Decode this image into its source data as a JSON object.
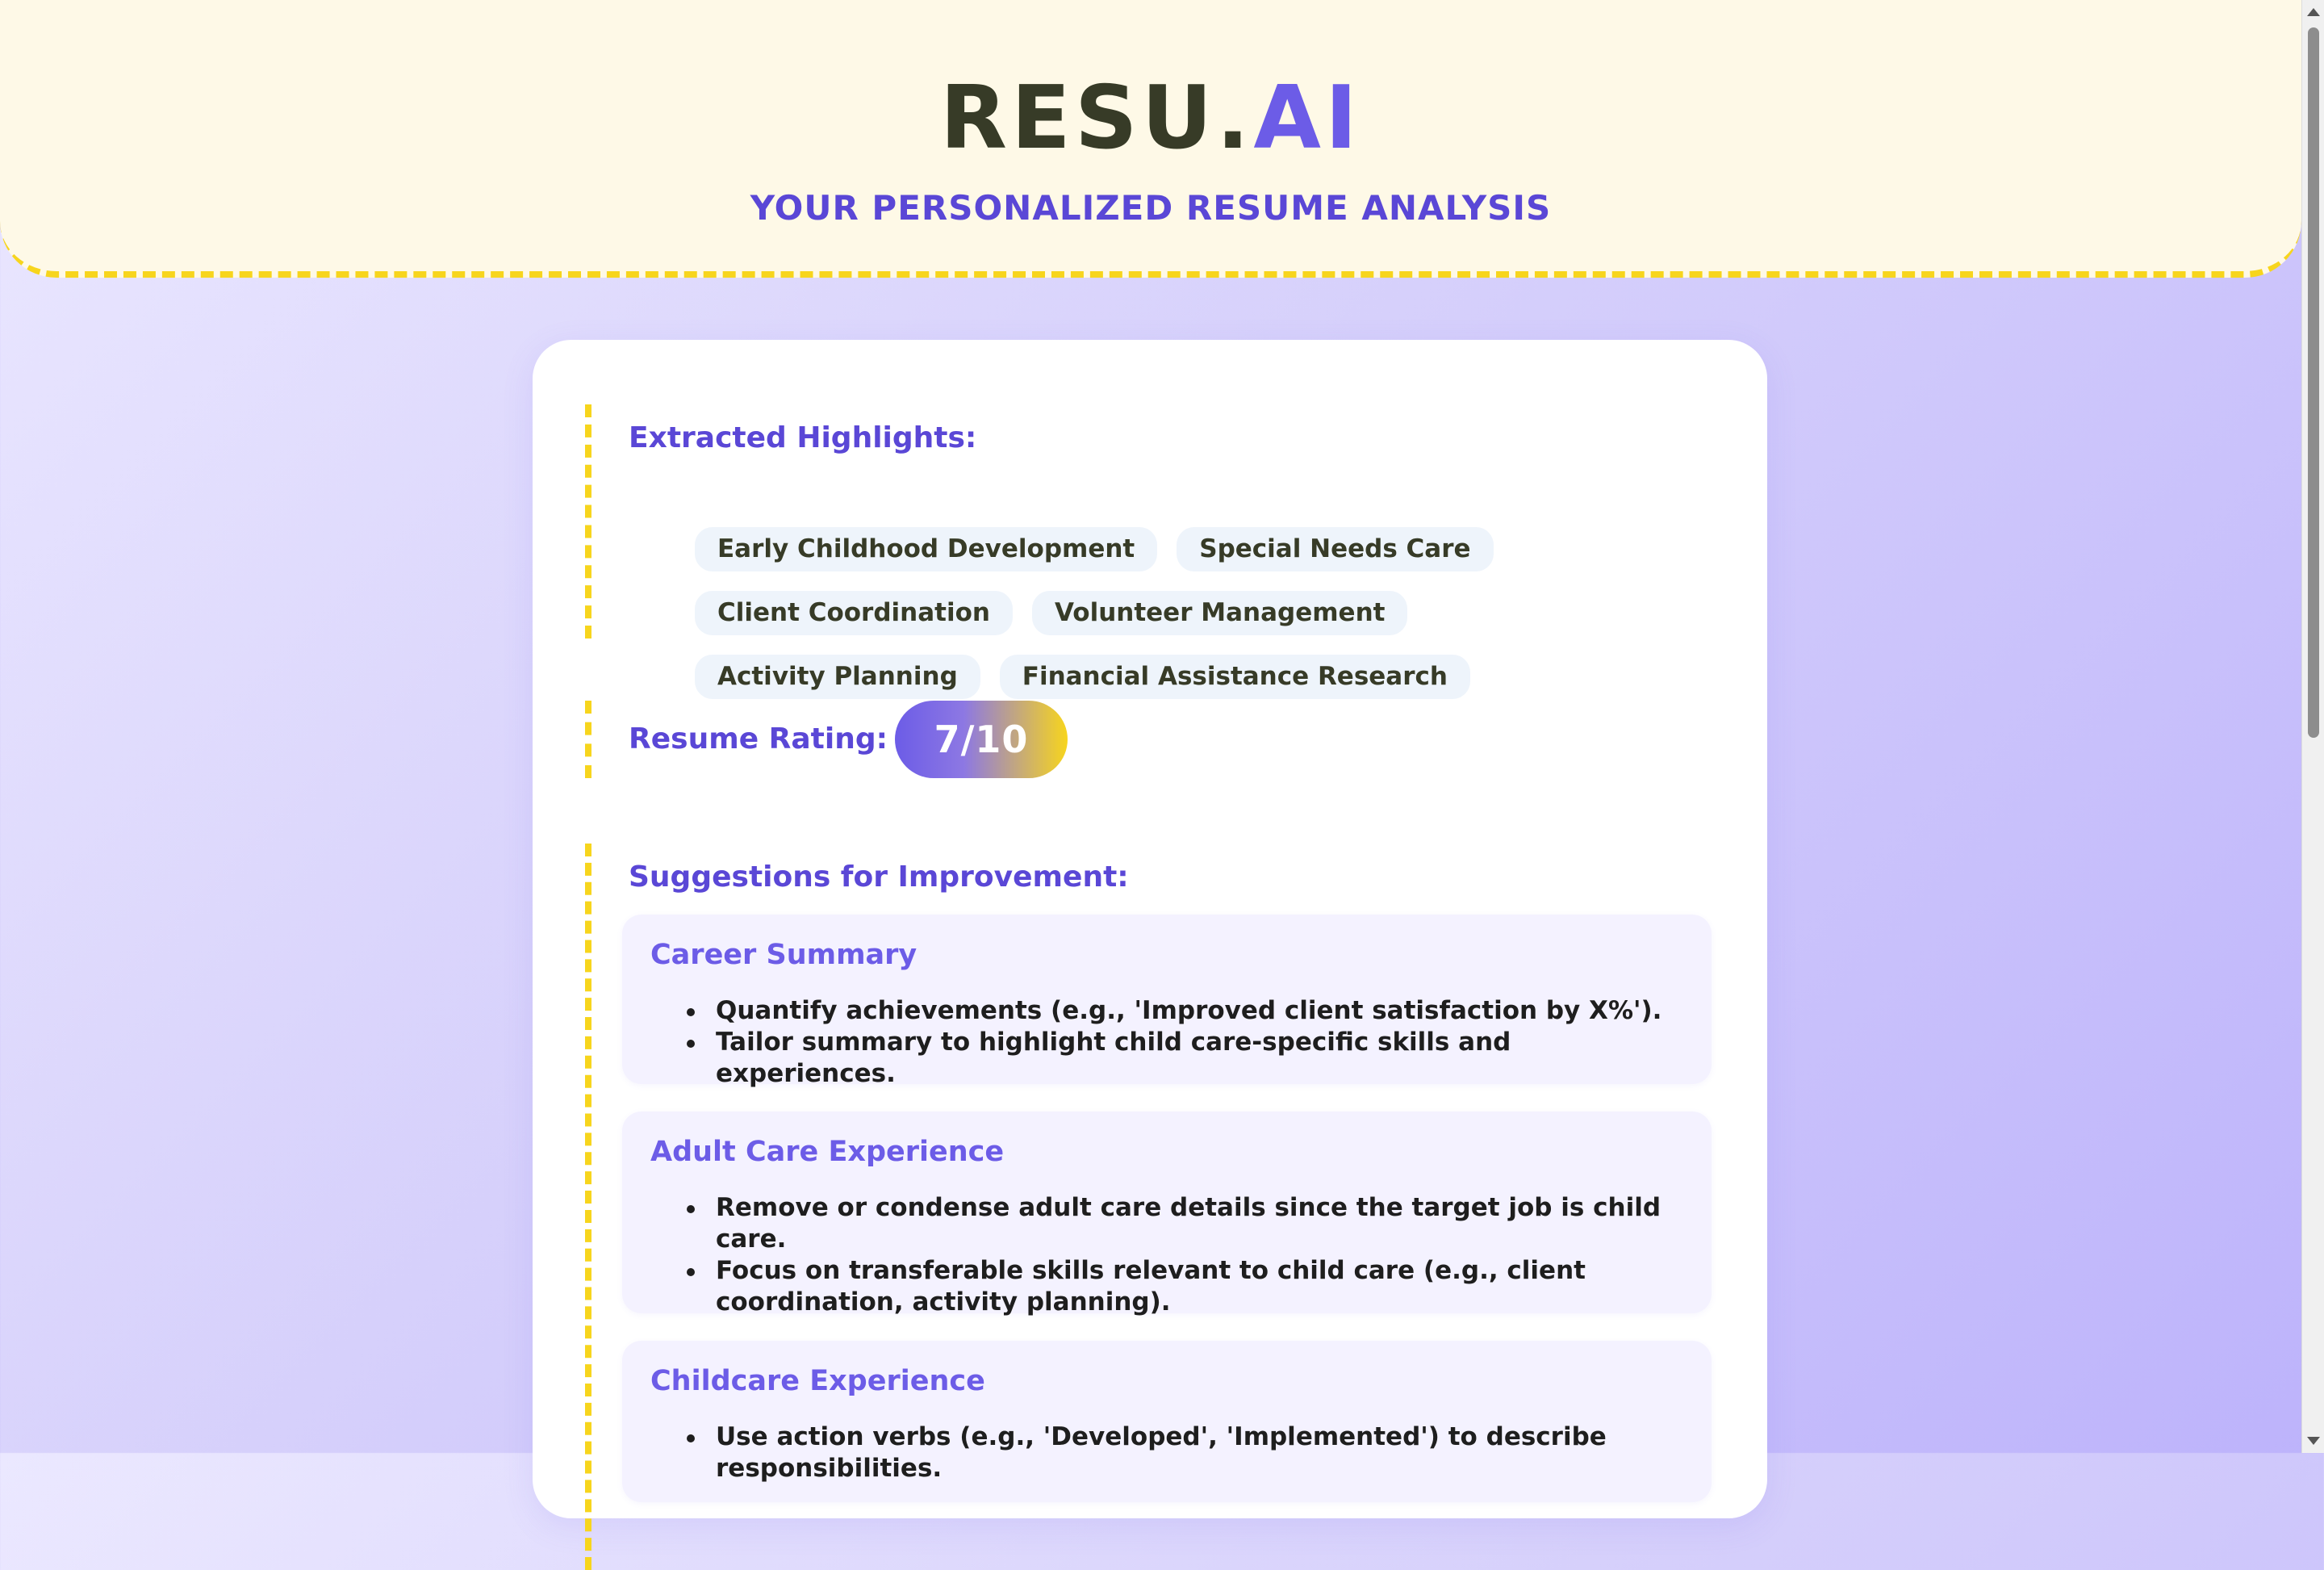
{
  "header": {
    "logo_main": "RESU.",
    "logo_accent": "AI",
    "tagline": "YOUR PERSONALIZED RESUME ANALYSIS"
  },
  "highlights": {
    "title": "Extracted Highlights:",
    "chips": [
      "Early Childhood Development",
      "Special Needs Care",
      "Client Coordination",
      "Volunteer Management",
      "Activity Planning",
      "Financial Assistance Research"
    ]
  },
  "rating": {
    "label": "Resume Rating:",
    "value": "7/10"
  },
  "suggestions": {
    "title": "Suggestions for Improvement:",
    "items": [
      {
        "title": "Career Summary",
        "bullets": [
          "Quantify achievements (e.g., 'Improved client satisfaction by X%').",
          "Tailor summary to highlight child care-specific skills and experiences."
        ]
      },
      {
        "title": "Adult Care Experience",
        "bullets": [
          "Remove or condense adult care details since the target job is child care.",
          "Focus on transferable skills relevant to child care (e.g., client coordination, activity planning)."
        ]
      },
      {
        "title": "Childcare Experience",
        "bullets": [
          "Use action verbs (e.g., 'Developed', 'Implemented') to describe responsibilities."
        ]
      }
    ]
  },
  "colors": {
    "accent": "#6c5ce7",
    "heading": "#5a47d6",
    "highlight_yellow": "#f7d51d",
    "header_bg": "#fef9e7"
  },
  "icons": [
    "scroll-up-arrow-icon",
    "scroll-down-arrow-icon",
    "bullet-icon"
  ]
}
